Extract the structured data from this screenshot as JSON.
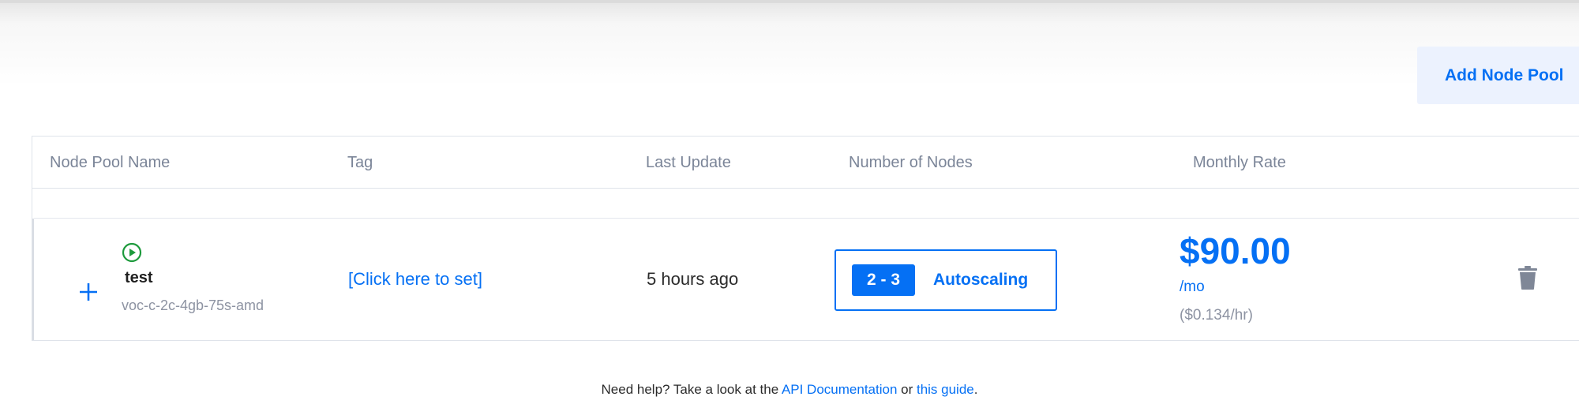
{
  "toolbar": {
    "add_node_pool_label": "Add Node Pool"
  },
  "table": {
    "headers": {
      "name": "Node Pool Name",
      "tag": "Tag",
      "last_update": "Last Update",
      "nodes": "Number of Nodes",
      "rate": "Monthly Rate"
    },
    "rows": [
      {
        "status_icon": "play-circle-icon",
        "status_color": "#1d9a3c",
        "name": "test",
        "plan": "voc-c-2c-4gb-75s-amd",
        "tag": "[Click here to set]",
        "last_update": "5 hours ago",
        "nodes_range": "2 - 3",
        "scaling_label": "Autoscaling",
        "monthly_price": "$90.00",
        "per_month": "/mo",
        "hourly": "($0.134/hr)",
        "expand_icon": "plus-icon",
        "delete_icon": "trash-icon"
      }
    ]
  },
  "help": {
    "prefix": "Need help? Take a look at the ",
    "api_link": "API Documentation",
    "middle": " or ",
    "guide_link": "this guide",
    "suffix": "."
  },
  "colors": {
    "accent": "#0570f4",
    "button_bg": "#ecf2fe",
    "muted_text": "#7b8598",
    "border": "#dfe3ea"
  }
}
